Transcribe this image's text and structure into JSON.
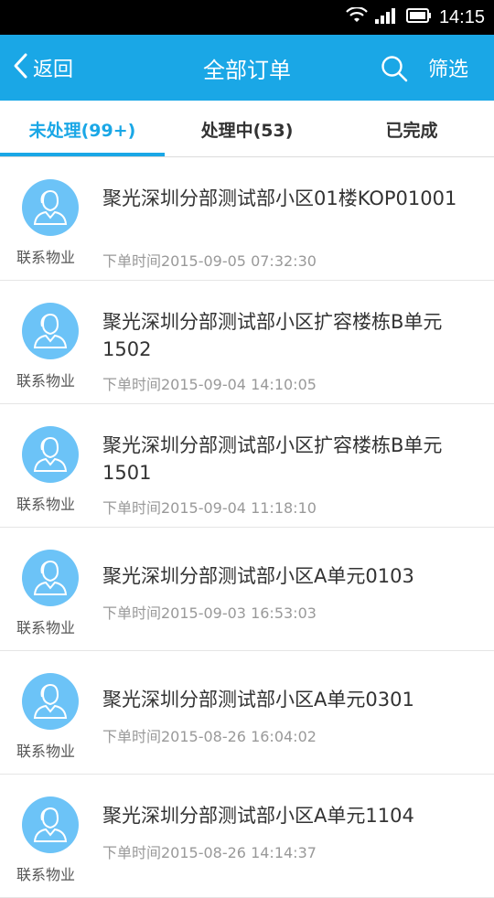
{
  "status_bar": {
    "time": "14:15"
  },
  "nav": {
    "back_label": "返回",
    "title": "全部订单",
    "filter_label": "筛选"
  },
  "tabs": [
    {
      "label": "未处理(99+)",
      "active": true
    },
    {
      "label": "处理中(53)",
      "active": false
    },
    {
      "label": "已完成",
      "active": false
    }
  ],
  "orders": [
    {
      "title": "聚光深圳分部测试部小区01楼KOP01001",
      "time": "下单时间2015-09-05 07:32:30",
      "contact": "联系物业"
    },
    {
      "title": "聚光深圳分部测试部小区扩容楼栋B单元1502",
      "time": "下单时间2015-09-04 14:10:05",
      "contact": "联系物业"
    },
    {
      "title": "聚光深圳分部测试部小区扩容楼栋B单元1501",
      "time": "下单时间2015-09-04 11:18:10",
      "contact": "联系物业"
    },
    {
      "title": "聚光深圳分部测试部小区A单元0103",
      "time": "下单时间2015-09-03 16:53:03",
      "contact": "联系物业"
    },
    {
      "title": "聚光深圳分部测试部小区A单元0301",
      "time": "下单时间2015-08-26 16:04:02",
      "contact": "联系物业"
    },
    {
      "title": "聚光深圳分部测试部小区A单元1104",
      "time": "下单时间2015-08-26 14:14:37",
      "contact": "联系物业"
    }
  ],
  "colors": {
    "accent": "#1aa7e6",
    "avatar": "#6cc3f7"
  }
}
